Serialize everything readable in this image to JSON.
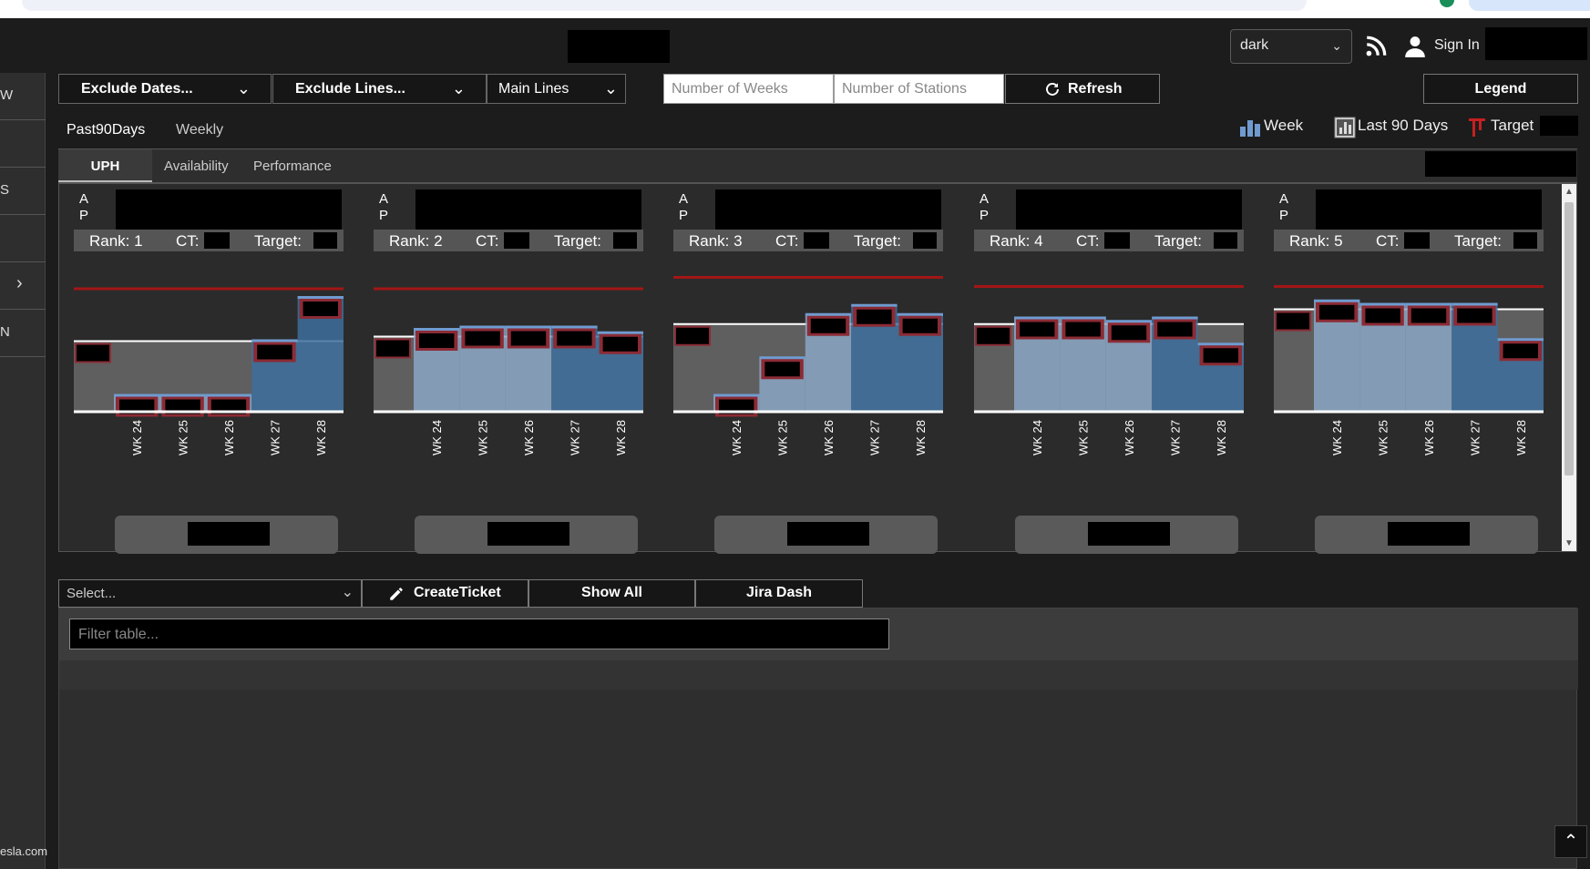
{
  "header": {
    "theme_value": "dark",
    "sign_in_label": "Sign In"
  },
  "sidebar": {
    "items": [
      "W",
      "",
      "S",
      "",
      "",
      "N"
    ],
    "footer": "esla.com"
  },
  "filters": {
    "exclude_dates_label": "Exclude Dates...",
    "exclude_lines_label": "Exclude Lines...",
    "line_group_value": "Main Lines",
    "weeks_placeholder": "Number of Weeks",
    "stations_placeholder": "Number of Stations",
    "refresh_label": "Refresh",
    "legend_label": "Legend"
  },
  "tabs": {
    "period": [
      "Past90Days",
      "Weekly"
    ],
    "metric": [
      "UPH",
      "Availability",
      "Performance"
    ]
  },
  "legend": {
    "week_label": "Week",
    "last90_label": "Last 90 Days",
    "target_label": "Target"
  },
  "colors": {
    "bar_light": "#8aa6c4",
    "bar_dark": "#3d6e9c",
    "target_line": "#a31616",
    "baseline": "#ffffff",
    "label_box": "#8b2b35",
    "band": "#5f5f5f"
  },
  "chart_data": [
    {
      "type": "bar",
      "ap_label": [
        "A",
        "P"
      ],
      "rank_label": "Rank: 1",
      "ct_label": "CT:",
      "target_label": "Target:",
      "categories": [
        "WK 24",
        "WK 25",
        "WK 26",
        "WK 27",
        "WK 28"
      ],
      "values": [
        0.14,
        0.14,
        0.14,
        0.62,
        1.0
      ],
      "last90": 0.62,
      "target": 1.08,
      "ylim": [
        0,
        1.2
      ]
    },
    {
      "type": "bar",
      "ap_label": [
        "A",
        "P"
      ],
      "rank_label": "Rank: 2",
      "ct_label": "CT:",
      "target_label": "Target:",
      "categories": [
        "WK 24",
        "WK 25",
        "WK 26",
        "WK 27",
        "WK 28"
      ],
      "values": [
        0.72,
        0.74,
        0.74,
        0.74,
        0.69
      ],
      "last90": 0.66,
      "target": 1.08,
      "ylim": [
        0,
        1.2
      ]
    },
    {
      "type": "bar",
      "ap_label": [
        "A",
        "P"
      ],
      "rank_label": "Rank: 3",
      "ct_label": "CT:",
      "target_label": "Target:",
      "categories": [
        "WK 24",
        "WK 25",
        "WK 26",
        "WK 27",
        "WK 28"
      ],
      "values": [
        0.14,
        0.47,
        0.85,
        0.93,
        0.85
      ],
      "last90": 0.77,
      "target": 1.18,
      "ylim": [
        0,
        1.2
      ]
    },
    {
      "type": "bar",
      "ap_label": [
        "A",
        "P"
      ],
      "rank_label": "Rank: 4",
      "ct_label": "CT:",
      "target_label": "Target:",
      "categories": [
        "WK 24",
        "WK 25",
        "WK 26",
        "WK 27",
        "WK 28"
      ],
      "values": [
        0.82,
        0.82,
        0.79,
        0.82,
        0.59
      ],
      "last90": 0.77,
      "target": 1.1,
      "ylim": [
        0,
        1.2
      ]
    },
    {
      "type": "bar",
      "ap_label": [
        "A",
        "P"
      ],
      "rank_label": "Rank: 5",
      "ct_label": "CT:",
      "target_label": "Target:",
      "categories": [
        "WK 24",
        "WK 25",
        "WK 26",
        "WK 27",
        "WK 28"
      ],
      "values": [
        0.97,
        0.94,
        0.94,
        0.94,
        0.63
      ],
      "last90": 0.9,
      "target": 1.1,
      "ylim": [
        0,
        1.2
      ]
    }
  ],
  "ticket_bar": {
    "select_placeholder": "Select...",
    "create_ticket_label": "CreateTicket",
    "show_all_label": "Show All",
    "jira_label": "Jira Dash"
  },
  "table": {
    "filter_placeholder": "Filter table..."
  }
}
